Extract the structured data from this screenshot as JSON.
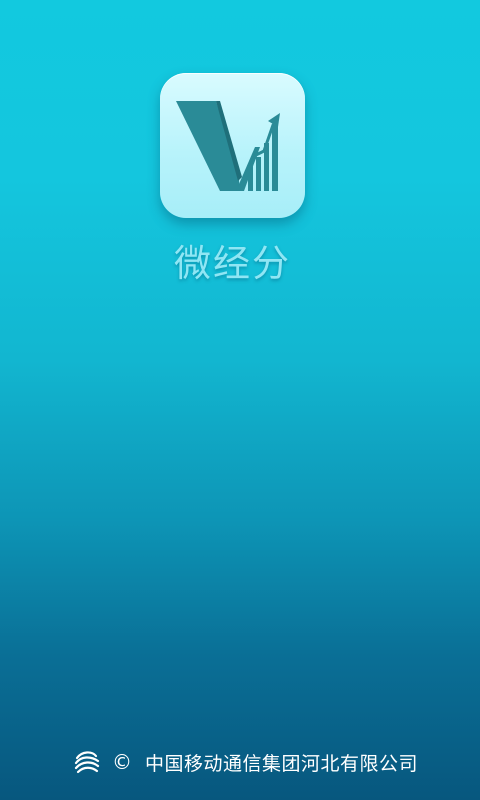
{
  "app": {
    "name": "微经分",
    "icon": "v-growth-chart-logo"
  },
  "footer": {
    "logo": "china-mobile-logo-icon",
    "copyright_symbol": "©",
    "company": "中国移动通信集团河北有限公司"
  },
  "colors": {
    "background_top": "#12c9df",
    "background_bottom": "#07577e",
    "icon_background": "#c7f6fc",
    "icon_mark": "#2a8b97",
    "app_name": "#8fe6f4",
    "footer_text": "#ffffff"
  }
}
